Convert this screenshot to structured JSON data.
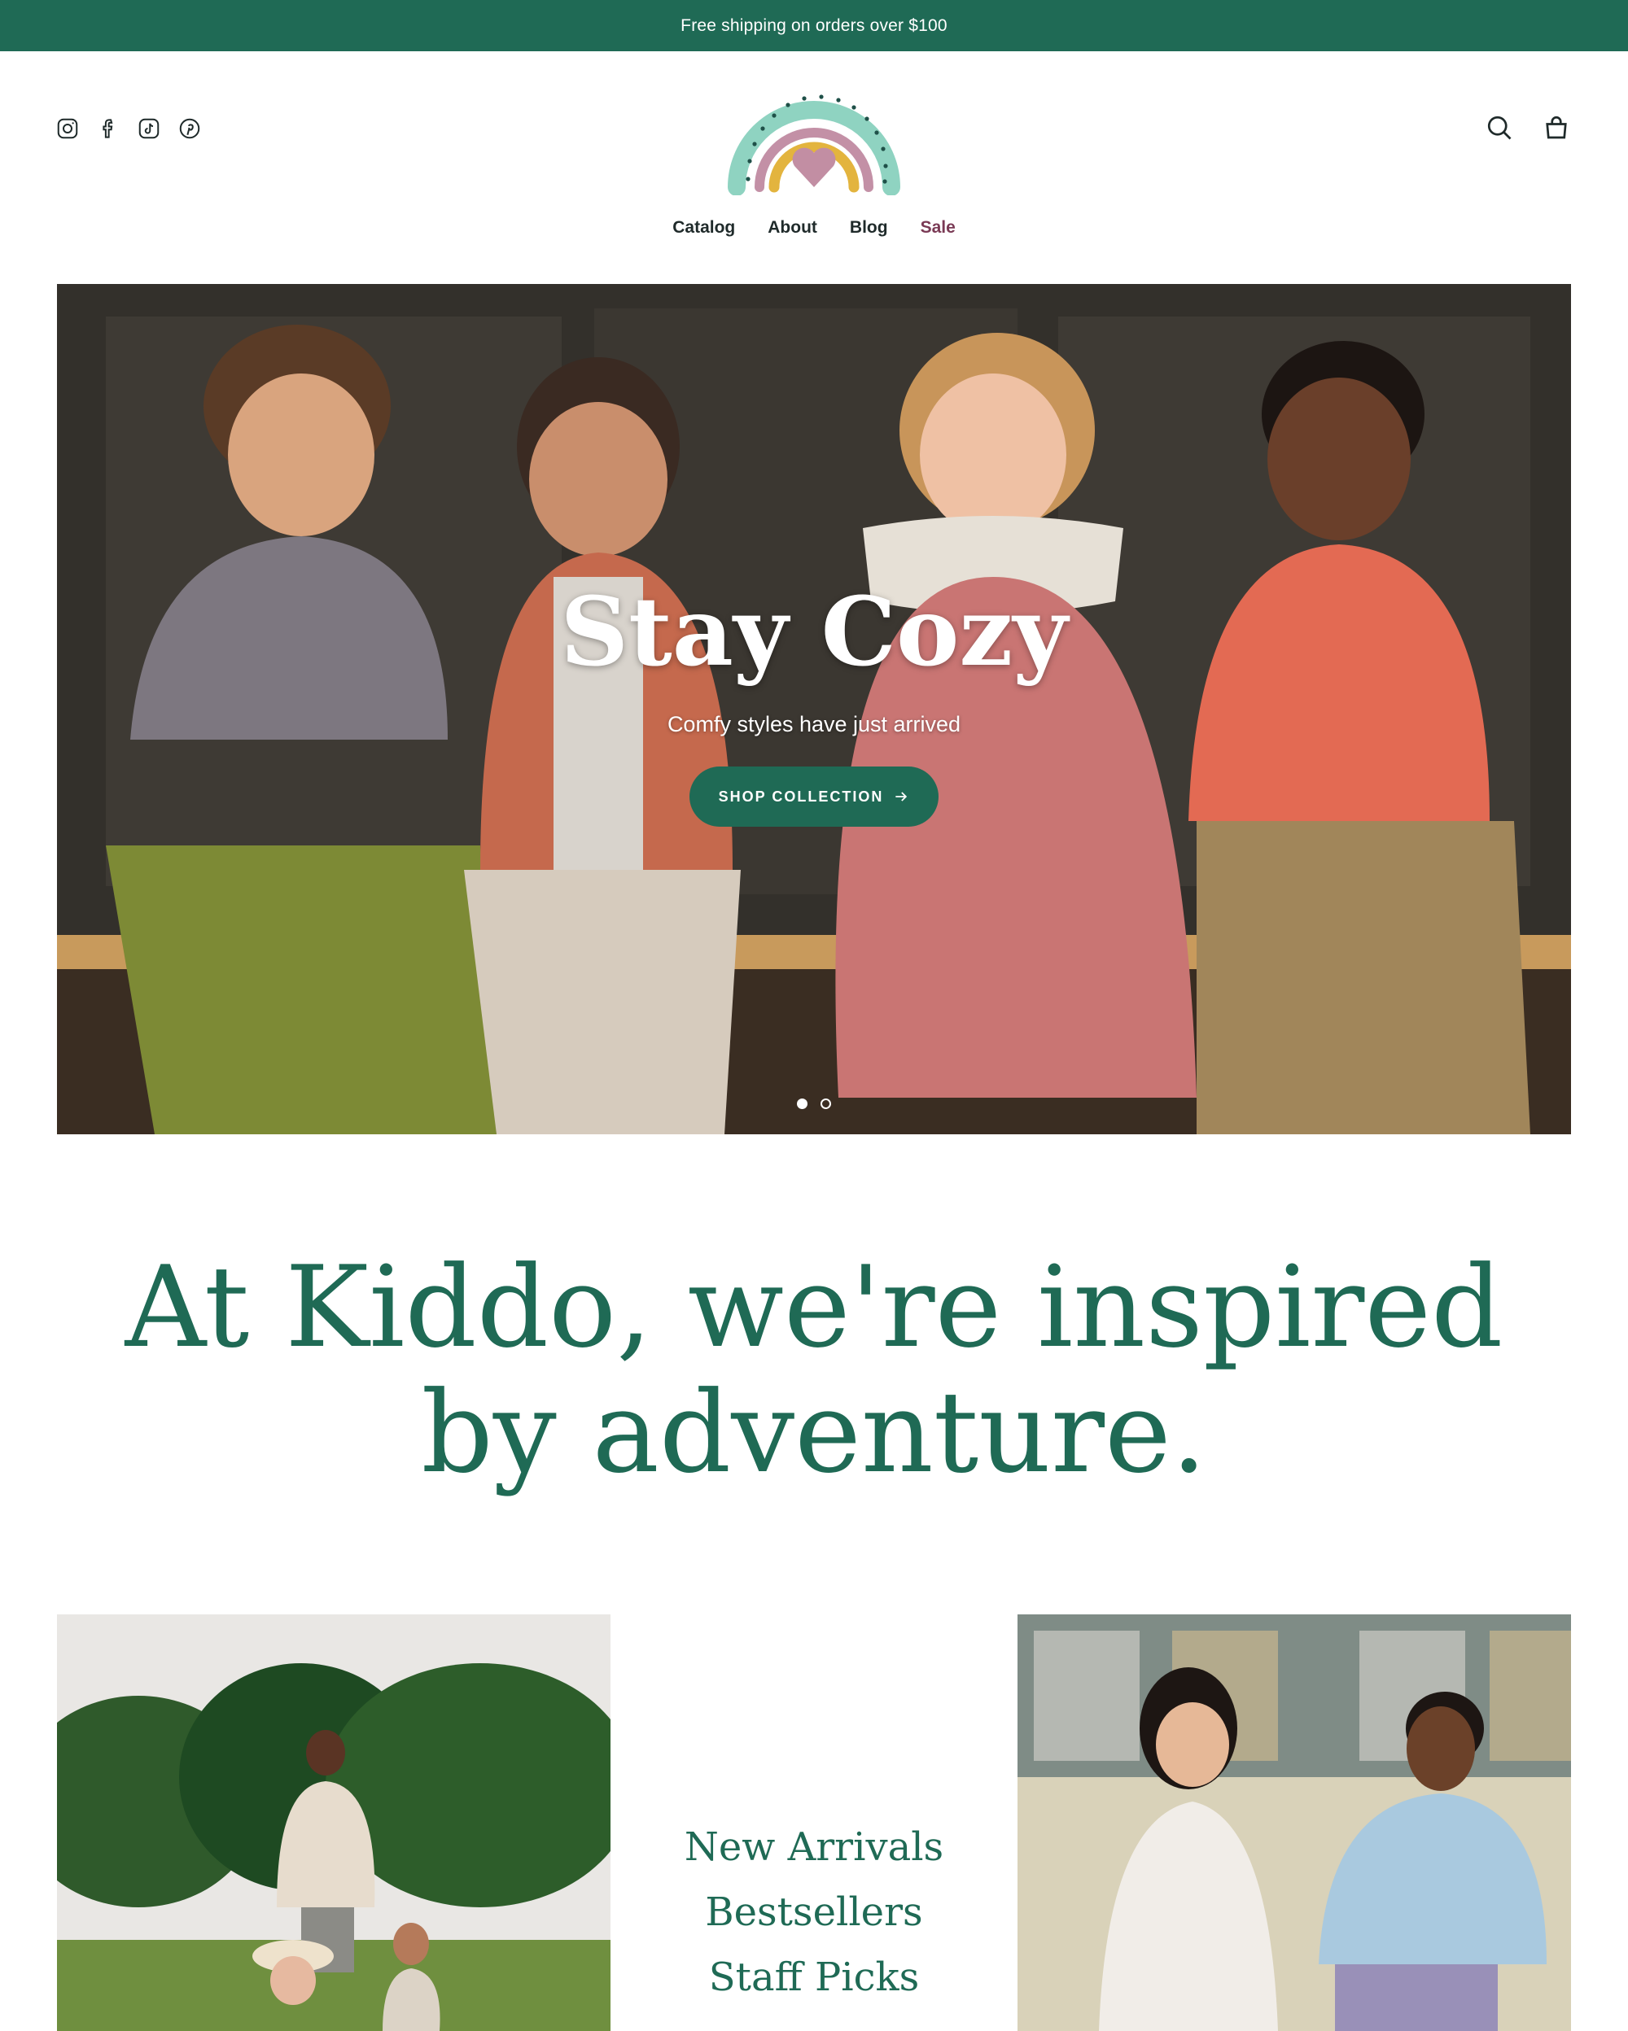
{
  "announcement": {
    "text": "Free shipping on orders over $100"
  },
  "header": {
    "social_icons": [
      "instagram-icon",
      "facebook-icon",
      "tiktok-icon",
      "pinterest-icon"
    ],
    "logo": "rainbow-heart-logo",
    "actions": [
      "search-icon",
      "cart-icon"
    ]
  },
  "nav": {
    "items": [
      {
        "label": "Catalog"
      },
      {
        "label": "About"
      },
      {
        "label": "Blog"
      },
      {
        "label": "Sale"
      }
    ]
  },
  "hero": {
    "title": "Stay Cozy",
    "subtitle": "Comfy styles have just arrived",
    "button_label": "SHOP COLLECTION",
    "slides_total": 2,
    "active_slide": 1
  },
  "intro": {
    "line1": "At Kiddo, we're inspired",
    "line2": "by adventure."
  },
  "collections": {
    "items": [
      "New Arrivals",
      "Bestsellers",
      "Staff Picks"
    ]
  },
  "colors": {
    "brand_green": "#1f6a55",
    "sale": "#7a3a55",
    "text": "#1f2a2a"
  }
}
